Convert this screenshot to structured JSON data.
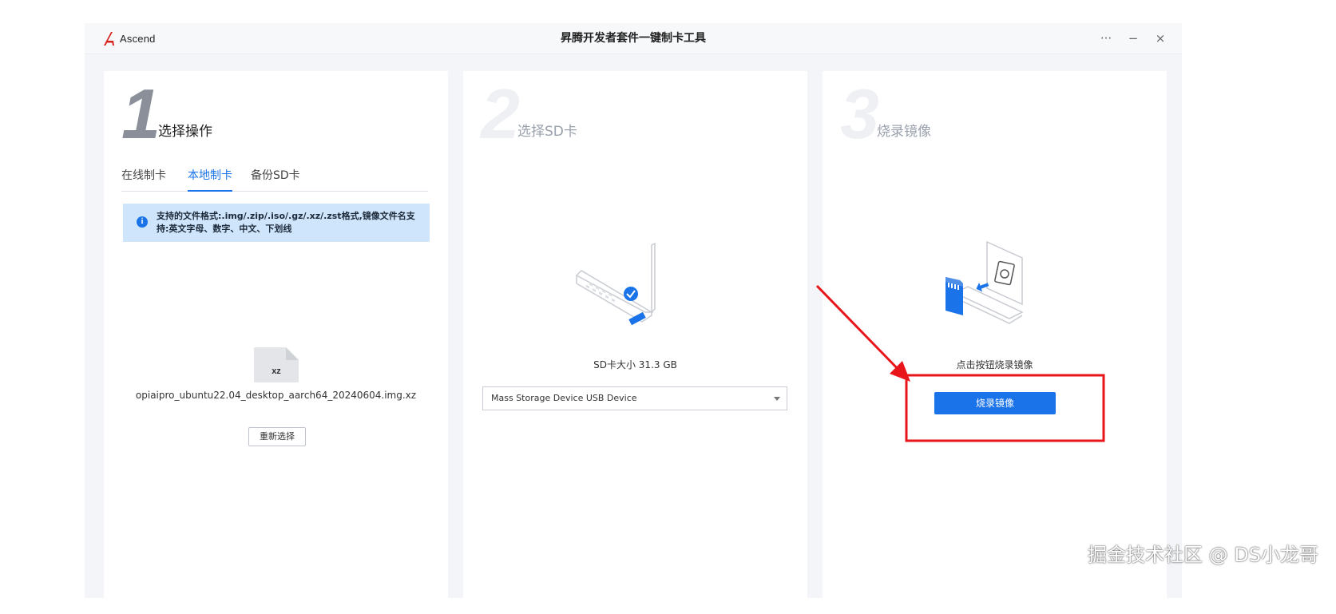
{
  "app": {
    "brand": "Ascend",
    "title": "昇腾开发者套件一键制卡工具",
    "controls": {
      "more": "···",
      "minimize": "−",
      "close": "×"
    }
  },
  "step1": {
    "number": "1",
    "title": "选择操作",
    "tabs": [
      {
        "label": "在线制卡",
        "active": false
      },
      {
        "label": "本地制卡",
        "active": true
      },
      {
        "label": "备份SD卡",
        "active": false
      }
    ],
    "info_icon": "i",
    "info": "支持的文件格式:.img/.zip/.iso/.gz/.xz/.zst格式,镜像文件名支持:英文字母、数字、中文、下划线",
    "file_ext": "xz",
    "file_name": "opiaipro_ubuntu22.04_desktop_aarch64_20240604.img.xz",
    "reselect_label": "重新选择"
  },
  "step2": {
    "number": "2",
    "title": "选择SD卡",
    "sd_size": "SD卡大小  31.3  GB",
    "device_selected": "Mass  Storage  Device  USB  Device"
  },
  "step3": {
    "number": "3",
    "title": "烧录镜像",
    "hint": "点击按钮烧录镜像",
    "burn_label": "烧录镜像"
  },
  "watermark": "掘金技术社区 @ DS小龙哥",
  "colors": {
    "accent": "#1a73e8",
    "annotation": "#e8161a",
    "info_bg": "#cfe5fb"
  }
}
